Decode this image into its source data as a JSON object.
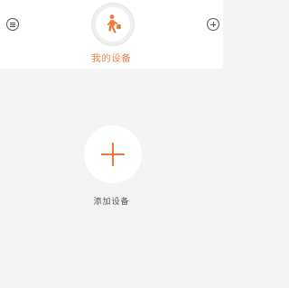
{
  "header": {
    "title": "我的设备",
    "menu_icon": "menu-icon",
    "add_icon": "plus-circle-icon",
    "avatar_icon": "walking-person-icon"
  },
  "main": {
    "add_device_label": "添加设备",
    "add_device_icon": "plus-icon"
  },
  "colors": {
    "accent": "#ec7a3c",
    "background": "#f4f4f4",
    "header_background": "#ffffff",
    "icon_gray": "#555555"
  }
}
